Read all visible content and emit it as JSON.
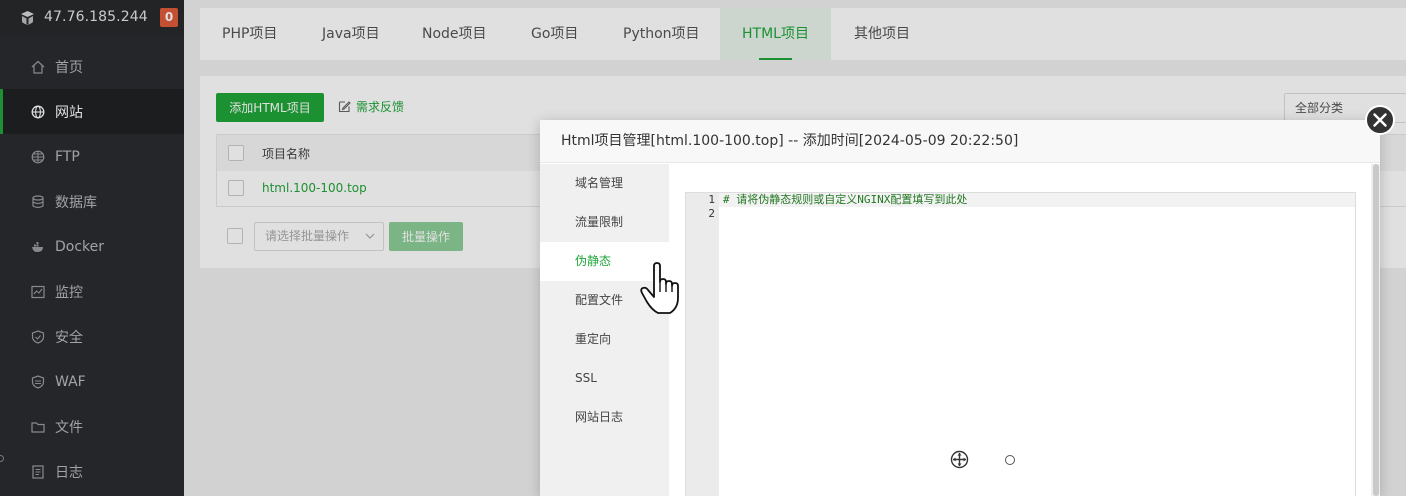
{
  "sidebar": {
    "server_ip": "47.76.185.244",
    "badge_count": "0",
    "items": [
      {
        "label": "首页",
        "icon": "home-icon"
      },
      {
        "label": "网站",
        "icon": "globe-icon"
      },
      {
        "label": "FTP",
        "icon": "ftp-globe-icon"
      },
      {
        "label": "数据库",
        "icon": "database-icon"
      },
      {
        "label": "Docker",
        "icon": "docker-icon"
      },
      {
        "label": "监控",
        "icon": "monitor-icon"
      },
      {
        "label": "安全",
        "icon": "shield-icon"
      },
      {
        "label": "WAF",
        "icon": "waf-icon"
      },
      {
        "label": "文件",
        "icon": "folder-icon"
      },
      {
        "label": "日志",
        "icon": "log-icon"
      }
    ],
    "active_item": "网站"
  },
  "tabs": [
    {
      "label": "PHP项目"
    },
    {
      "label": "Java项目"
    },
    {
      "label": "Node项目"
    },
    {
      "label": "Go项目"
    },
    {
      "label": "Python项目"
    },
    {
      "label": "HTML项目"
    },
    {
      "label": "其他项目"
    }
  ],
  "active_tab": "HTML项目",
  "toolbar": {
    "add_button": "添加HTML项目",
    "feedback": "需求反馈",
    "category_select": "全部分类"
  },
  "table": {
    "columns": [
      "项目名称"
    ],
    "rows": [
      {
        "name": "html.100-100.top"
      }
    ]
  },
  "batch": {
    "placeholder": "请选择批量操作",
    "button": "批量操作"
  },
  "modal": {
    "title": "Html项目管理[html.100-100.top] -- 添加时间[2024-05-09 20:22:50]",
    "nav": [
      {
        "label": "域名管理"
      },
      {
        "label": "流量限制"
      },
      {
        "label": "伪静态"
      },
      {
        "label": "配置文件"
      },
      {
        "label": "重定向"
      },
      {
        "label": "SSL"
      },
      {
        "label": "网站日志"
      }
    ],
    "active_nav": "伪静态",
    "editor": {
      "lines": [
        {
          "number": "1",
          "text": "# 请将伪静态规则或自定义NGINX配置填写到此处"
        },
        {
          "number": "2",
          "text": ""
        }
      ]
    }
  },
  "colors": {
    "brand_green": "#20a53a",
    "sidebar_bg": "#2a2c30",
    "badge": "#e15b3a"
  }
}
